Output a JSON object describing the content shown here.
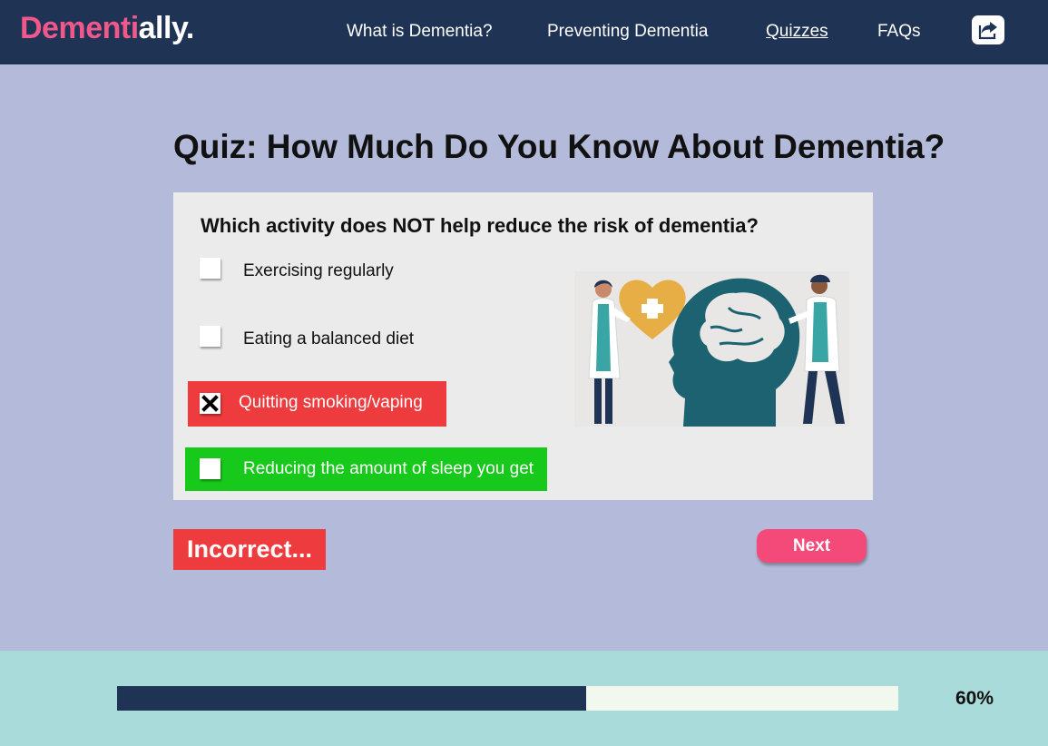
{
  "header": {
    "logo_part1": "Dementi",
    "logo_part2": "ally.",
    "nav": [
      {
        "label": "What is Dementia?"
      },
      {
        "label": "Preventing Dementia"
      },
      {
        "label": "Quizzes",
        "active": true
      },
      {
        "label": "FAQs"
      }
    ],
    "share_icon": "share-icon"
  },
  "quiz": {
    "title": "Quiz: How Much Do You Know About Dementia?",
    "question": "Which activity does NOT help reduce the risk of dementia?",
    "options": [
      {
        "label": "Exercising regularly",
        "state": "unselected"
      },
      {
        "label": "Eating a balanced diet",
        "state": "unselected"
      },
      {
        "label": "Quitting smoking/vaping",
        "state": "selected-incorrect"
      },
      {
        "label": "Reducing the amount of sleep you get",
        "state": "correct-answer"
      }
    ],
    "illustration_icon": "doctors-brain-heart-illustration",
    "feedback": "Incorrect...",
    "next_label": "Next"
  },
  "progress": {
    "value": 0.6,
    "label": "60%"
  },
  "colors": {
    "navy": "#1f3354",
    "pink": "#f0578a",
    "incorrect_red": "#ee3b3d",
    "correct_green": "#17c91a",
    "background": "#b4bad9",
    "footer": "#a9dbdb"
  }
}
